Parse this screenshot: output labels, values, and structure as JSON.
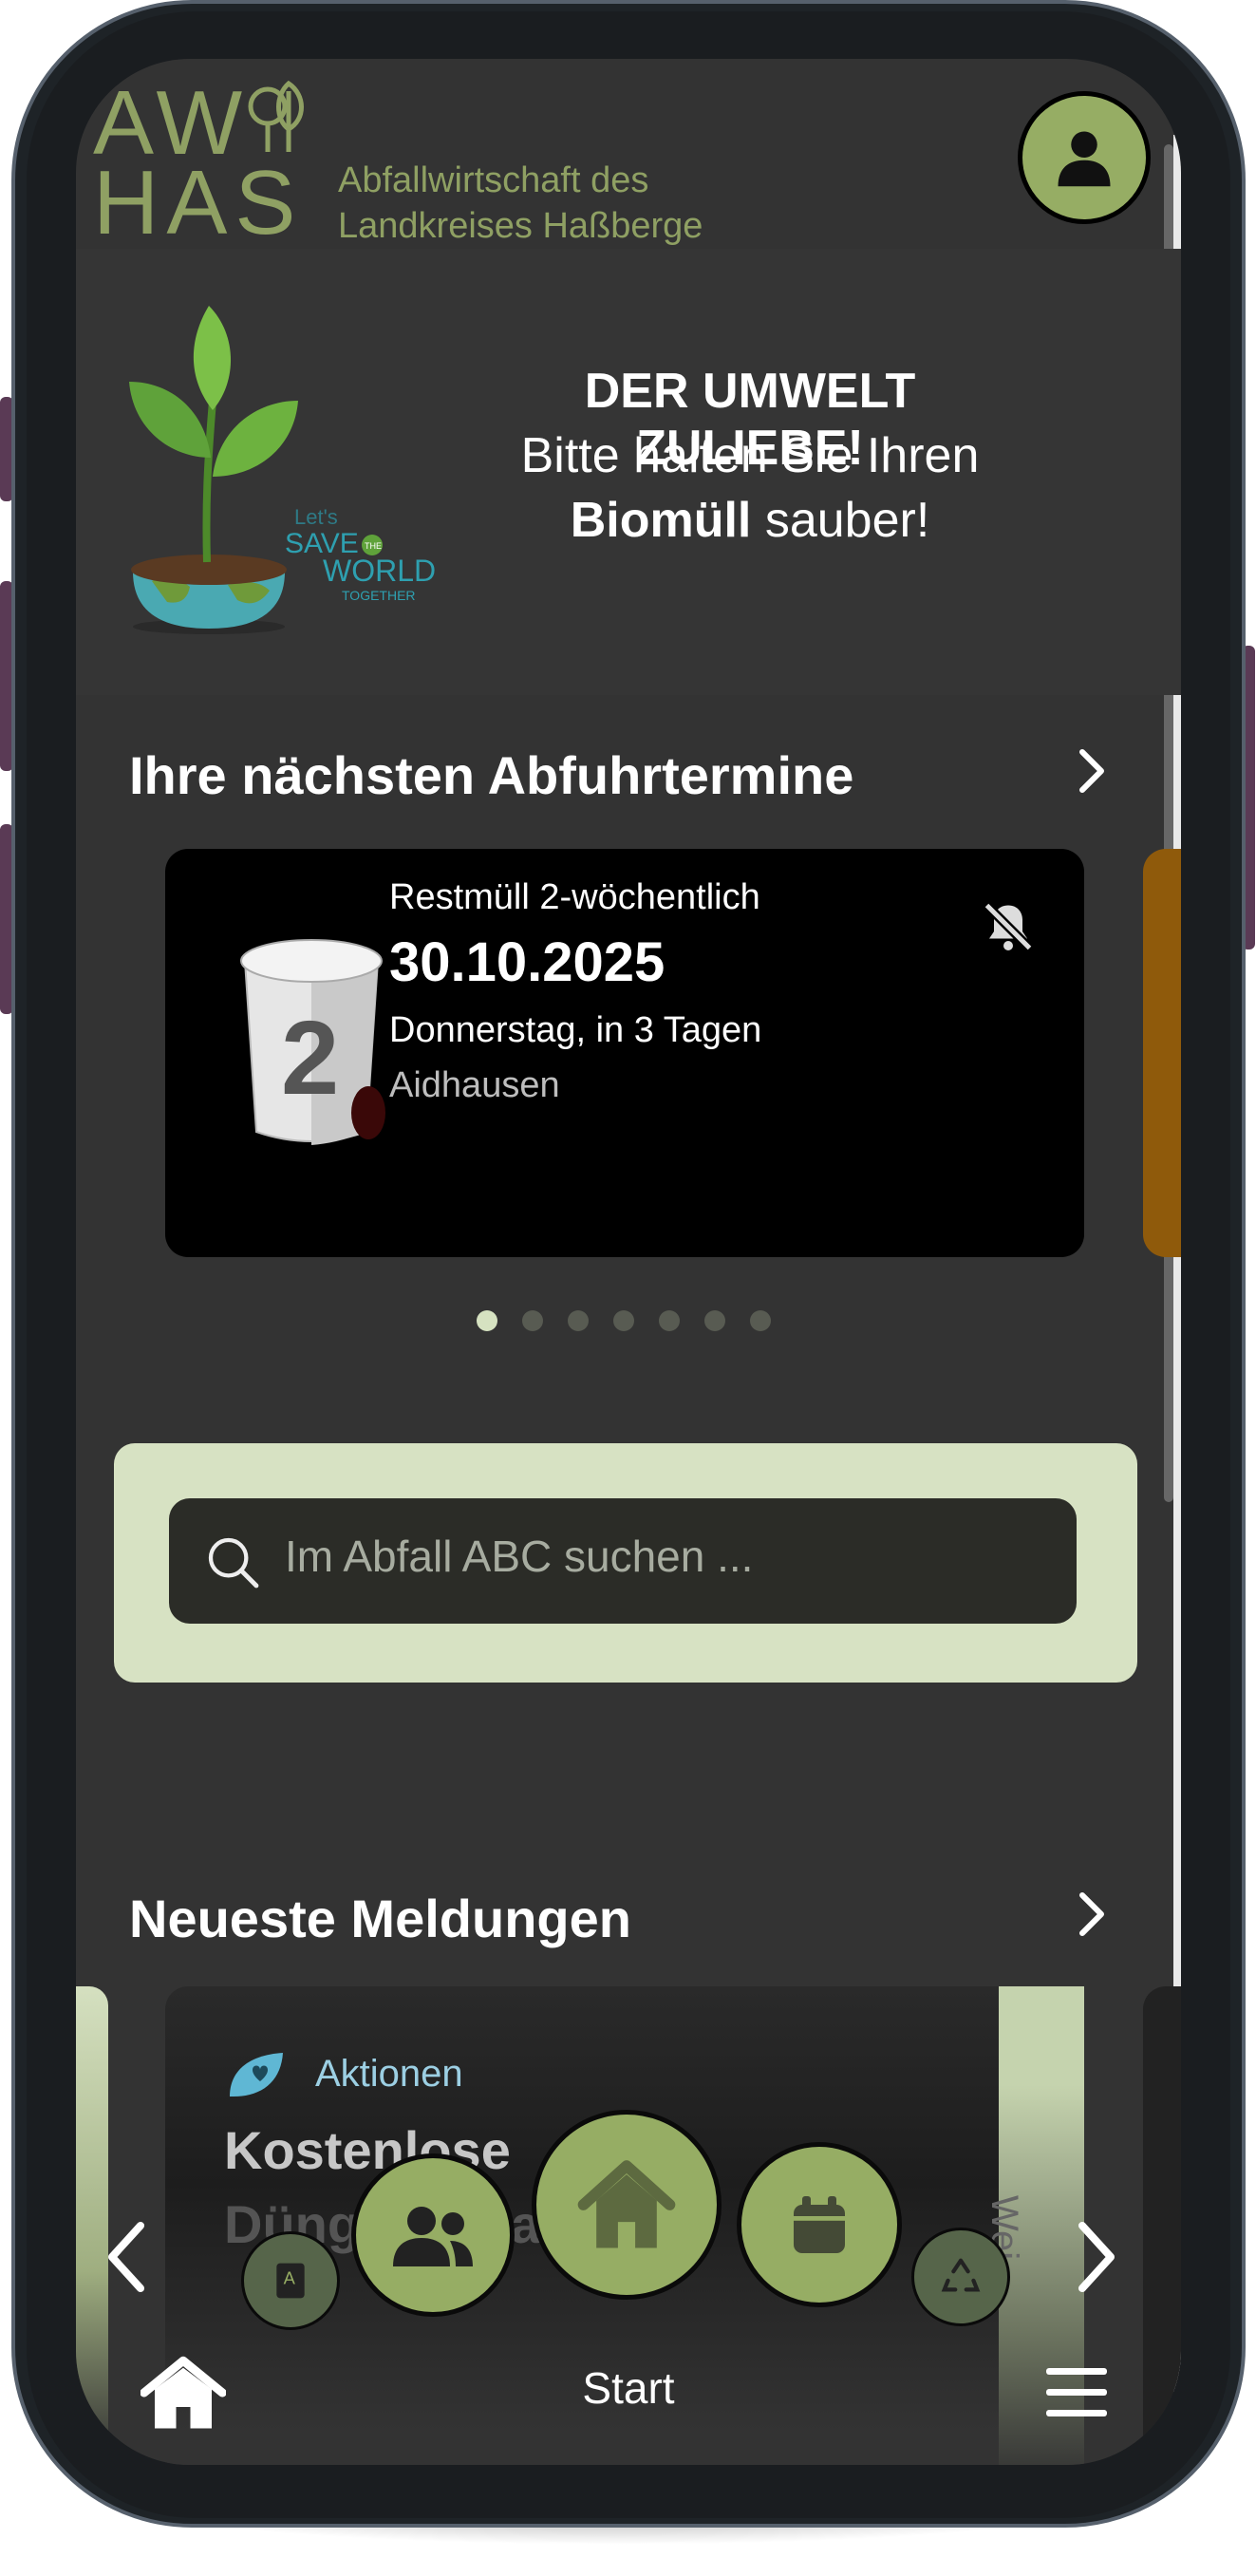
{
  "header": {
    "logo_line1": "AW",
    "logo_line2": "HAS",
    "org_name_line1": "Abfallwirtschaft des",
    "org_name_line2": "Landkreises Haßberge"
  },
  "banner": {
    "headline": "DER UMWELT ZULIEBE!",
    "line2": "Bitte halten Sie Ihren",
    "line3_bold": "Biomüll",
    "line3_rest": " sauber!",
    "art_text1": "Let's",
    "art_text2": "SAVE",
    "art_text3": "THE",
    "art_text4": "WORLD",
    "art_text5": "TOGETHER"
  },
  "pickups": {
    "title": "Ihre nächsten Abfuhrtermine",
    "card": {
      "bin_number": "2",
      "type": "Restmüll 2-wöchentlich",
      "date": "30.10.2025",
      "day": "Donnerstag, in 3 Tagen",
      "place": "Aidhausen"
    },
    "dots": 7,
    "active_dot": 0
  },
  "search": {
    "placeholder": "Im Abfall ABC suchen ..."
  },
  "news": {
    "title": "Neueste Meldungen",
    "card": {
      "category": "Aktionen",
      "title_line1": "Kostenlose",
      "title_line2": "Düngeaussaat im"
    },
    "peek_vertical": "Wei"
  },
  "bottom_nav": {
    "current": "Start"
  },
  "colors": {
    "accent": "#96ad64",
    "light_accent": "#d7e2c3",
    "background": "#333333",
    "card": "#000000",
    "next_card": "#8f5a0b"
  },
  "icons": {
    "avatar": "user-icon",
    "pickup_chevron": "chevron-right-icon",
    "bell_off": "bell-off-icon",
    "search": "search-icon",
    "news_category": "leaf-heart-icon",
    "fab_book": "book-a-icon",
    "fab_users": "users-icon",
    "fab_home": "home-icon",
    "fab_calendar": "calendar-icon",
    "fab_recycle": "recycle-icon",
    "nav_home": "home-icon",
    "nav_menu": "hamburger-menu-icon"
  }
}
